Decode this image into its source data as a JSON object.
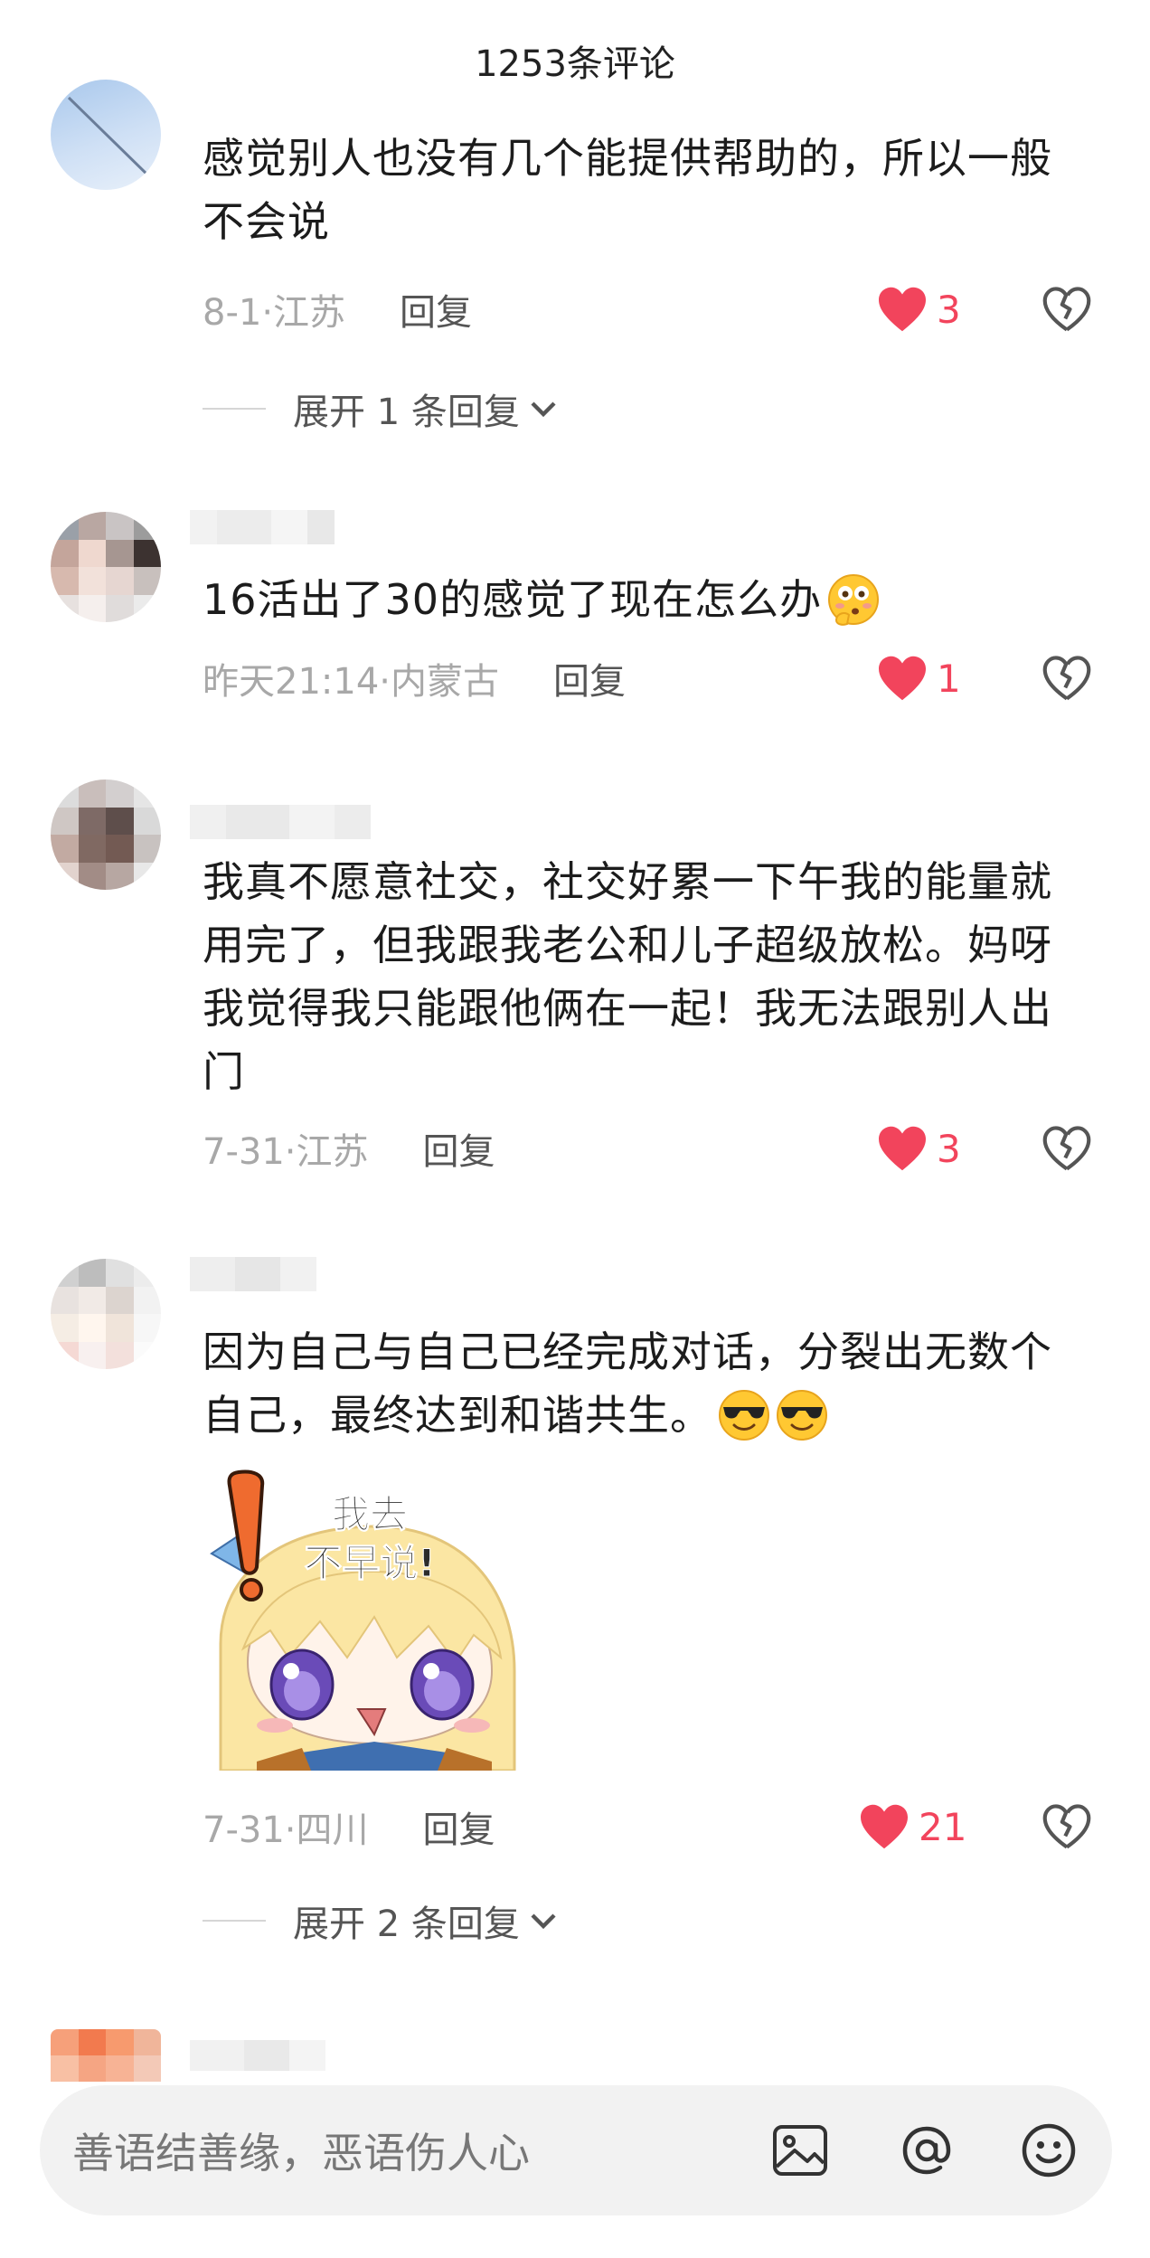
{
  "header": {
    "title": "1253条评论"
  },
  "comments": [
    {
      "text": "感觉别人也没有几个能提供帮助的，所以一般不会说",
      "date": "8-1·江苏",
      "reply_label": "回复",
      "likes": "3",
      "expand": "展开 1 条回复"
    },
    {
      "text": "16活出了30的感觉了现在怎么办",
      "emoji": "flushed-thinking-emoji",
      "date": "昨天21:14·内蒙古",
      "reply_label": "回复",
      "likes": "1"
    },
    {
      "text": "我真不愿意社交，社交好累一下午我的能量就用完了，但我跟我老公和儿子超级放松。妈呀我觉得我只能跟他俩在一起！我无法跟别人出门",
      "date": "7-31·江苏",
      "reply_label": "回复",
      "likes": "3"
    },
    {
      "text": "因为自己与自己已经完成对话，分裂出无数个自己，最终达到和谐共生。",
      "emoji": "sunglasses-emoji",
      "sticker_text": "我去\n不早说!",
      "date": "7-31·四川",
      "reply_label": "回复",
      "likes": "21",
      "expand": "展开 2 条回复"
    }
  ],
  "input": {
    "placeholder": "善语结善缘，恶语伤人心"
  },
  "icons": {
    "like": "heart-icon",
    "dislike": "broken-heart-icon",
    "image": "image-icon",
    "mention": "at-icon",
    "emoji": "smiley-icon",
    "expand": "chevron-down-icon"
  },
  "colors": {
    "like": "#f2445c",
    "meta": "#a8a8a8",
    "text": "#1c1c1c"
  }
}
